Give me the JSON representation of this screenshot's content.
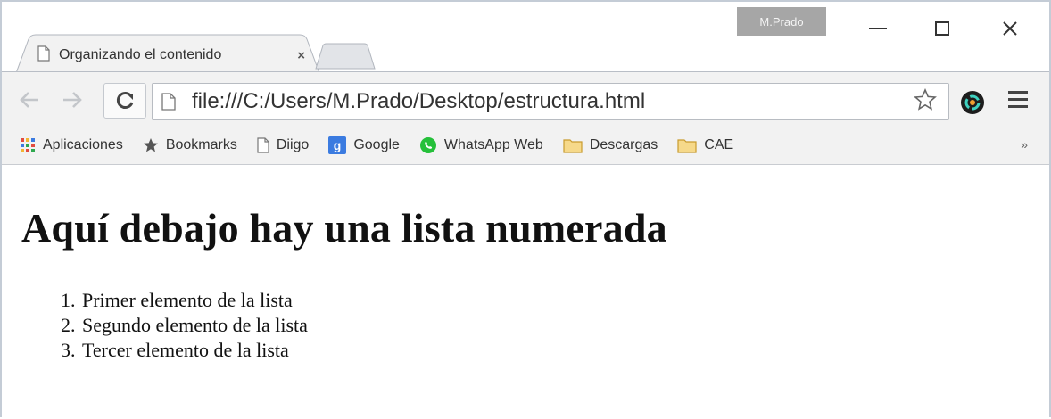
{
  "window": {
    "profile_name": "M.Prado"
  },
  "tabs": [
    {
      "title": "Organizando el contenido",
      "close": "×"
    }
  ],
  "toolbar": {
    "url": "file:///C:/Users/M.Prado/Desktop/estructura.html"
  },
  "bookmarks": {
    "items": [
      {
        "label": "Aplicaciones",
        "icon": "apps-grid-icon"
      },
      {
        "label": "Bookmarks",
        "icon": "star-icon"
      },
      {
        "label": "Diigo",
        "icon": "page-icon"
      },
      {
        "label": "Google",
        "icon": "google-icon"
      },
      {
        "label": "WhatsApp Web",
        "icon": "whatsapp-icon"
      },
      {
        "label": "Descargas",
        "icon": "folder-icon"
      },
      {
        "label": "CAE",
        "icon": "folder-icon"
      }
    ],
    "overflow": "»"
  },
  "page": {
    "heading": "Aquí debajo hay una lista numerada",
    "list": [
      "Primer elemento de la lista",
      "Segundo elemento de la lista",
      "Tercer elemento de la lista"
    ]
  },
  "colors": {
    "chrome_background": "#f2f2f2",
    "google_icon": "#3b7be0",
    "whatsapp_icon": "#25c03a",
    "folder_icon": "#e8c15a"
  }
}
